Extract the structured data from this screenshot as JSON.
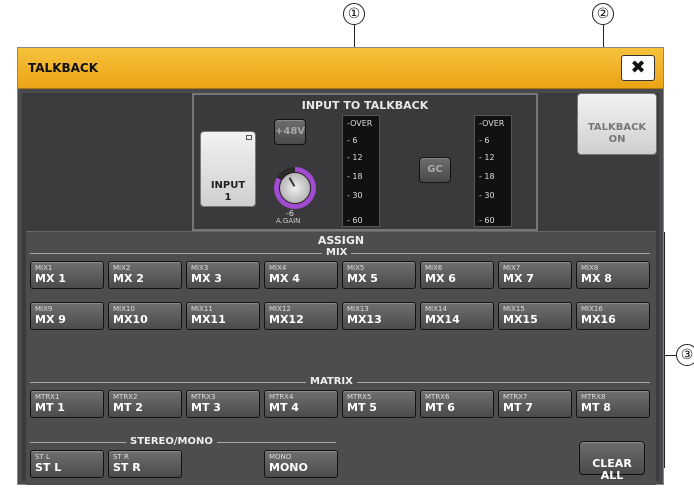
{
  "callouts": [
    "①",
    "②",
    "③"
  ],
  "window": {
    "title": "TALKBACK",
    "close_symbol": "✖"
  },
  "input_group": {
    "title": "INPUT TO TALKBACK",
    "input_button": "INPUT\n1",
    "phantom_label": "+48V",
    "gain_value": "-6",
    "gain_label": "A.GAIN",
    "gc_label": "GC",
    "meter_scale": [
      "-OVER",
      "6",
      "12",
      "18",
      "30",
      "60"
    ]
  },
  "talkback_on": "TALKBACK\nON",
  "assign": {
    "title": "ASSIGN",
    "mix_label": "MIX",
    "matrix_label": "MATRIX",
    "stereo_mono_label": "STEREO/MONO",
    "mix": [
      {
        "small": "MIX1",
        "big": "MX 1"
      },
      {
        "small": "MIX2",
        "big": "MX 2"
      },
      {
        "small": "MIX3",
        "big": "MX 3"
      },
      {
        "small": "MIX4",
        "big": "MX 4"
      },
      {
        "small": "MIX5",
        "big": "MX 5"
      },
      {
        "small": "MIX6",
        "big": "MX 6"
      },
      {
        "small": "MIX7",
        "big": "MX 7"
      },
      {
        "small": "MIX8",
        "big": "MX 8"
      },
      {
        "small": "MIX9",
        "big": "MX 9"
      },
      {
        "small": "MIX10",
        "big": "MX10"
      },
      {
        "small": "MIX11",
        "big": "MX11"
      },
      {
        "small": "MIX12",
        "big": "MX12"
      },
      {
        "small": "MIX13",
        "big": "MX13"
      },
      {
        "small": "MIX14",
        "big": "MX14"
      },
      {
        "small": "MIX15",
        "big": "MX15"
      },
      {
        "small": "MIX16",
        "big": "MX16"
      }
    ],
    "matrix": [
      {
        "small": "MTRX1",
        "big": "MT 1"
      },
      {
        "small": "MTRX2",
        "big": "MT 2"
      },
      {
        "small": "MTRX3",
        "big": "MT 3"
      },
      {
        "small": "MTRX4",
        "big": "MT 4"
      },
      {
        "small": "MTRX5",
        "big": "MT 5"
      },
      {
        "small": "MTRX6",
        "big": "MT 6"
      },
      {
        "small": "MTRX7",
        "big": "MT 7"
      },
      {
        "small": "MTRX8",
        "big": "MT 8"
      }
    ],
    "stereo_mono": [
      {
        "small": "ST L",
        "big": "ST L"
      },
      {
        "small": "ST R",
        "big": "ST R"
      },
      {
        "small": "MONO",
        "big": "MONO"
      }
    ],
    "clear_all": "CLEAR\nALL"
  },
  "colors": {
    "title_bar": "#eba416",
    "knob_ring": "#a04bd0",
    "panel": "#3c3c3e"
  }
}
